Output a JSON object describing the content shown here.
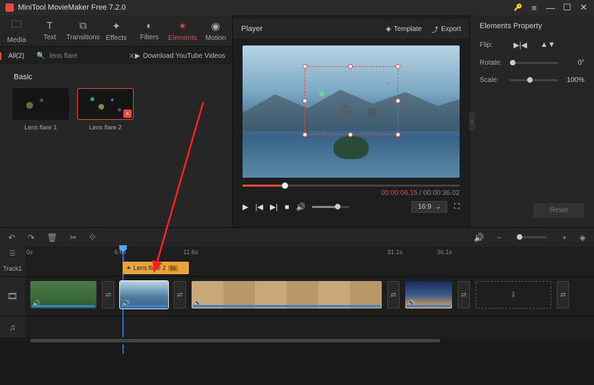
{
  "titlebar": {
    "app_title": "MiniTool MovieMaker Free 7.2.0"
  },
  "tabs": {
    "media": "Media",
    "text": "Text",
    "transitions": "Transitions",
    "effects": "Effects",
    "filters": "Filters",
    "elements": "Elements",
    "motion": "Motion"
  },
  "filter": {
    "all_label": "All(2)",
    "search_value": "lens flare",
    "download_label": "Download YouTube Videos"
  },
  "elements": {
    "category": "Basic",
    "items": [
      {
        "label": "Lens flare 1"
      },
      {
        "label": "Lens flare 2"
      }
    ]
  },
  "player": {
    "title": "Player",
    "template_label": "Template",
    "export_label": "Export",
    "time_current": "00:00:06.15",
    "time_total": "00:00:36.02",
    "aspect_ratio": "16:9"
  },
  "props": {
    "title": "Elements Property",
    "flip_label": "Flip:",
    "rotate_label": "Rotate:",
    "scale_label": "Scale:",
    "rotate_value": "0°",
    "scale_value": "100%",
    "reset_label": "Reset"
  },
  "timeline": {
    "ruler": [
      "0s",
      "6.6s",
      "11.6s",
      "31.1s",
      "36.1s"
    ],
    "track1_label": "Track1",
    "clip": {
      "label": "Lens flare 2",
      "duration": "5s"
    }
  }
}
